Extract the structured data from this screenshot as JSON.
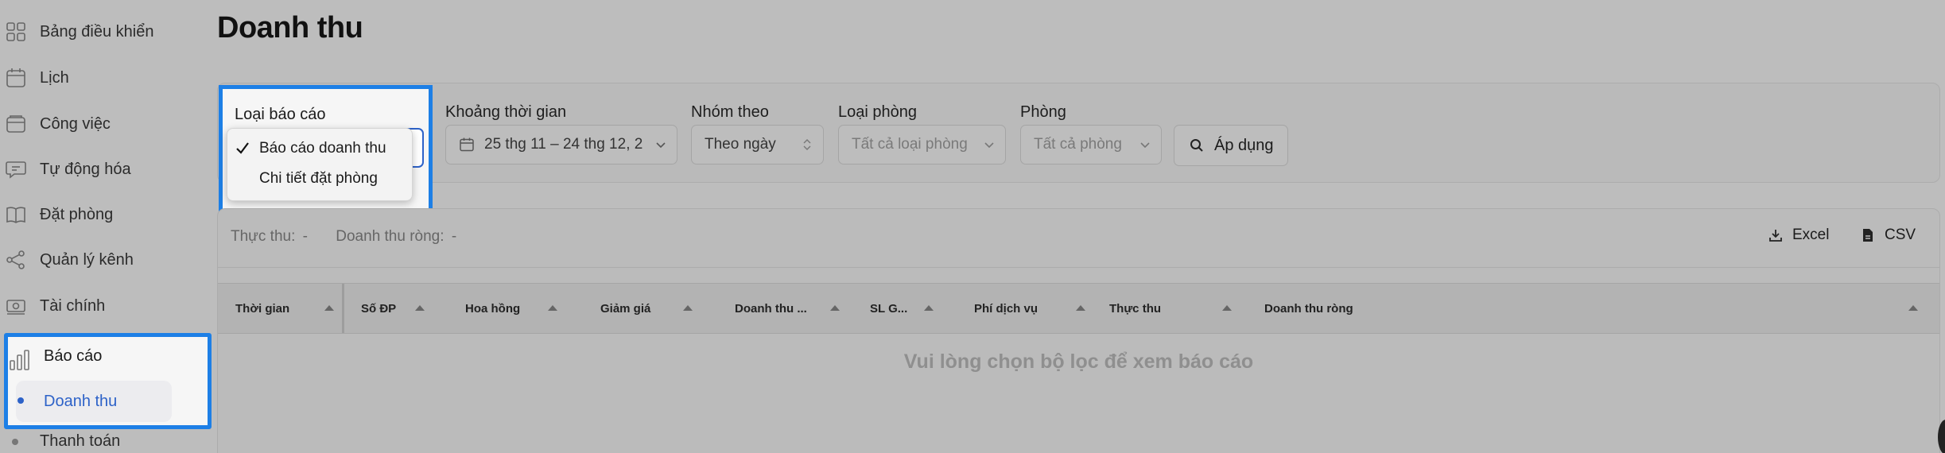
{
  "sidebar": {
    "items": [
      {
        "label": "Bảng điều khiển",
        "icon": "dashboard-icon"
      },
      {
        "label": "Lịch",
        "icon": "calendar-icon"
      },
      {
        "label": "Công việc",
        "icon": "tasks-icon"
      },
      {
        "label": "Tự động hóa",
        "icon": "chat-automation-icon"
      },
      {
        "label": "Đặt phòng",
        "icon": "book-icon"
      },
      {
        "label": "Quản lý kênh",
        "icon": "share-icon"
      },
      {
        "label": "Tài chính",
        "icon": "money-icon"
      }
    ],
    "reports": {
      "label": "Báo cáo",
      "icon": "bar-chart-icon"
    },
    "sub_items": [
      {
        "label": "Doanh thu",
        "active": true
      },
      {
        "label": "Thanh toán",
        "active": false
      }
    ]
  },
  "page": {
    "title": "Doanh thu"
  },
  "filters": {
    "report_type": {
      "label": "Loại báo cáo",
      "options": [
        "Báo cáo doanh thu",
        "Chi tiết đặt phòng"
      ],
      "selected": "Báo cáo doanh thu"
    },
    "date_range": {
      "label": "Khoảng thời gian",
      "value": "25 thg 11 – 24 thg 12, 2"
    },
    "group_by": {
      "label": "Nhóm theo",
      "value": "Theo ngày"
    },
    "room_type": {
      "label": "Loại phòng",
      "placeholder": "Tất cả loại phòng"
    },
    "room": {
      "label": "Phòng",
      "placeholder": "Tất cả phòng"
    },
    "apply_label": "Áp dụng"
  },
  "summary": {
    "actual_label": "Thực thu:",
    "actual_value": "-",
    "net_label": "Doanh thu ròng:",
    "net_value": "-"
  },
  "export": {
    "excel": "Excel",
    "csv": "CSV"
  },
  "table": {
    "columns": [
      "Thời gian",
      "Số ĐP",
      "Hoa hồng",
      "Giảm giá",
      "Doanh thu ...",
      "SL G...",
      "Phí dịch vụ",
      "Thực thu",
      "Doanh thu ròng"
    ],
    "empty_message": "Vui lòng chọn bộ lọc để xem báo cáo"
  },
  "colors": {
    "accent": "#2d62c8",
    "highlight_border": "#1d7fe6",
    "overlay_bg": "#bdbdbd"
  }
}
